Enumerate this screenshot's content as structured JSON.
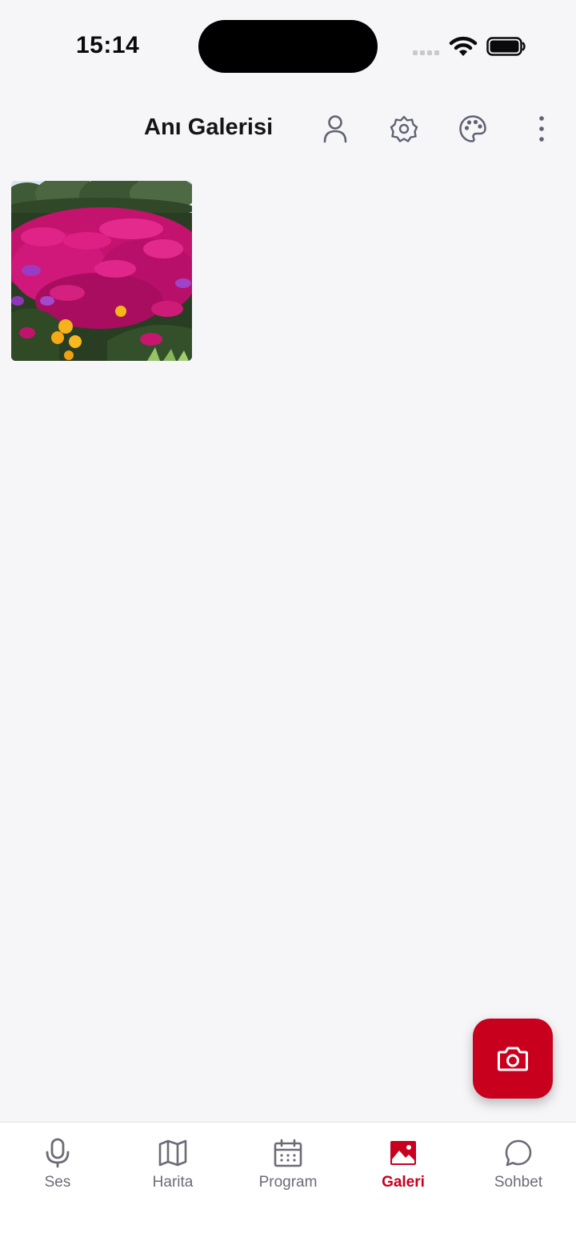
{
  "status_bar": {
    "time": "15:14"
  },
  "header": {
    "title": "Anı Galerisi",
    "icons": [
      "person-icon",
      "gear-icon",
      "palette-icon",
      "more-vertical-icon"
    ]
  },
  "gallery": {
    "photos": [
      {
        "subject": "flower-field"
      }
    ]
  },
  "fab": {
    "icon": "camera-icon",
    "color": "#c8001e"
  },
  "tabs": [
    {
      "label": "Ses",
      "icon": "mic-icon",
      "active": false
    },
    {
      "label": "Harita",
      "icon": "map-icon",
      "active": false
    },
    {
      "label": "Program",
      "icon": "calendar-icon",
      "active": false
    },
    {
      "label": "Galeri",
      "icon": "image-icon",
      "active": true
    },
    {
      "label": "Sohbet",
      "icon": "chat-bubble-icon",
      "active": false
    }
  ],
  "colors": {
    "accent": "#c8001e",
    "inactive": "#6b6b78",
    "background": "#f6f6f9"
  }
}
